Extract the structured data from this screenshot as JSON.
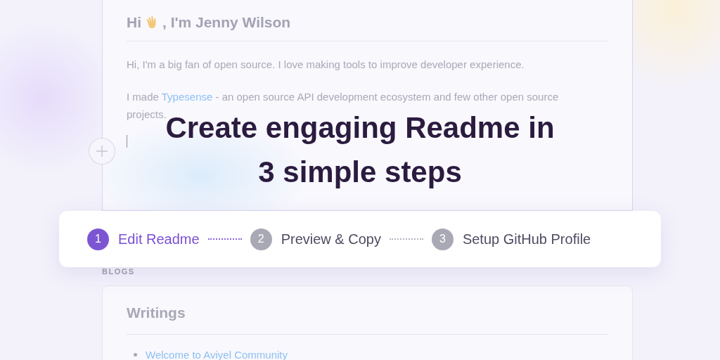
{
  "profile_card": {
    "heading_before": "Hi",
    "heading_after": ", I'm Jenny Wilson",
    "paragraphs": [
      {
        "before": "Hi, I'm a big fan of open source. I love making tools to improve developer experience."
      },
      {
        "before": "I made ",
        "link": "Typesense",
        "after": " - an open source API development ecosystem and few other open source projects."
      }
    ]
  },
  "headline": [
    "Create engaging Readme in",
    "3 simple steps"
  ],
  "steps": [
    {
      "number": "1",
      "label": "Edit Readme",
      "selected": true
    },
    {
      "number": "2",
      "label": "Preview & Copy",
      "selected": false
    },
    {
      "number": "3",
      "label": "Setup GitHub Profile",
      "selected": false
    }
  ],
  "blogs": {
    "section_label": "BLOGS",
    "title": "Writings",
    "items": [
      "Welcome to Aviyel Community"
    ]
  }
}
